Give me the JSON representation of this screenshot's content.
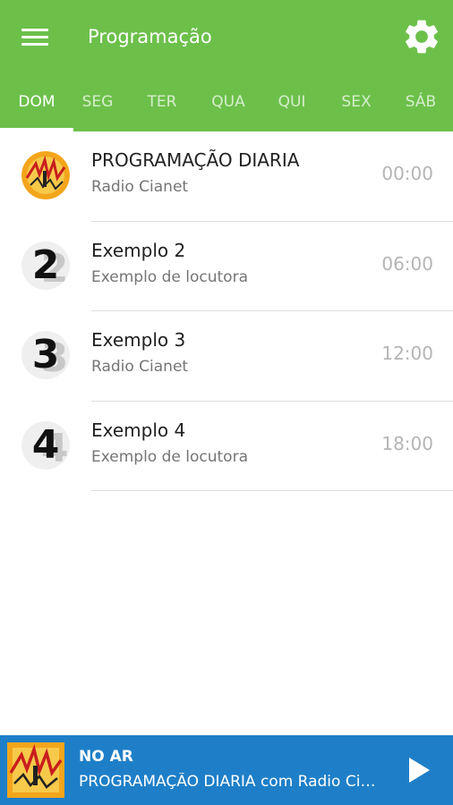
{
  "appbar": {
    "title": "Programação",
    "menu_icon": "hamburger-menu-icon",
    "settings_icon": "gear-icon",
    "color": "#6cc04a"
  },
  "tabs": [
    {
      "label": "DOM",
      "active": true
    },
    {
      "label": "SEG",
      "active": false
    },
    {
      "label": "TER",
      "active": false
    },
    {
      "label": "QUA",
      "active": false
    },
    {
      "label": "QUI",
      "active": false
    },
    {
      "label": "SEX",
      "active": false
    },
    {
      "label": "SÁB",
      "active": false
    }
  ],
  "schedule": [
    {
      "title": "PROGRAMAÇÃO DIARIA",
      "host": "Radio Cianet",
      "time": "00:00",
      "avatar": "radio-logo"
    },
    {
      "title": "Exemplo 2",
      "host": "Exemplo de locutora",
      "time": "06:00",
      "avatar": "2"
    },
    {
      "title": "Exemplo 3",
      "host": "Radio Cianet",
      "time": "12:00",
      "avatar": "3"
    },
    {
      "title": "Exemplo 4",
      "host": "Exemplo de locutora",
      "time": "18:00",
      "avatar": "4"
    }
  ],
  "player": {
    "label": "NO AR",
    "now_playing": "PROGRAMAÇÃO DIARIA com Radio Cianet",
    "play_icon": "play-icon",
    "color": "#1e7fc8"
  }
}
